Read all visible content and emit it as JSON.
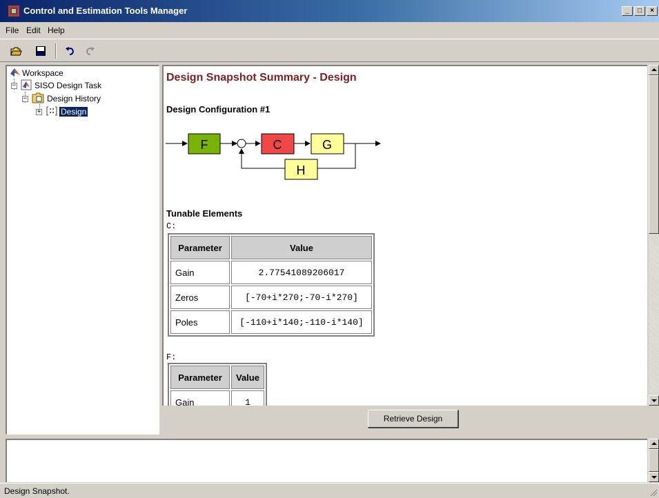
{
  "window": {
    "title": "Control and Estimation Tools Manager"
  },
  "menu": [
    "File",
    "Edit",
    "Help"
  ],
  "toolbar": {
    "icons": [
      "open-folder-icon",
      "save-icon",
      "undo-icon",
      "redo-icon"
    ]
  },
  "tree": {
    "items": [
      {
        "label": "Workspace"
      },
      {
        "label": "SISO Design Task"
      },
      {
        "label": "Design History"
      },
      {
        "label": "Design"
      }
    ]
  },
  "content": {
    "title": "Design Snapshot Summary - Design",
    "config_label": "Design Configuration #1",
    "diagram_blocks": {
      "f": "F",
      "c": "C",
      "g": "G",
      "h": "H"
    },
    "tunable_label": "Tunable Elements",
    "c_table": {
      "label": "C:",
      "headers": [
        "Parameter",
        "Value"
      ],
      "rows": [
        [
          "Gain",
          "2.77541089206017"
        ],
        [
          "Zeros",
          "[-70+i*270;-70-i*270]"
        ],
        [
          "Poles",
          "[-110+i*140;-110-i*140]"
        ]
      ]
    },
    "f_table": {
      "label": "F:",
      "headers": [
        "Parameter",
        "Value"
      ],
      "rows": [
        [
          "Gain",
          "1"
        ]
      ]
    }
  },
  "buttons": {
    "retrieve": "Retrieve Design"
  },
  "status": {
    "text": "Design Snapshot."
  },
  "colors": {
    "block_f": "#77b300",
    "block_c": "#f04848",
    "block_g": "#ffff99",
    "block_h": "#ffff99",
    "title": "#7f1f1f"
  }
}
